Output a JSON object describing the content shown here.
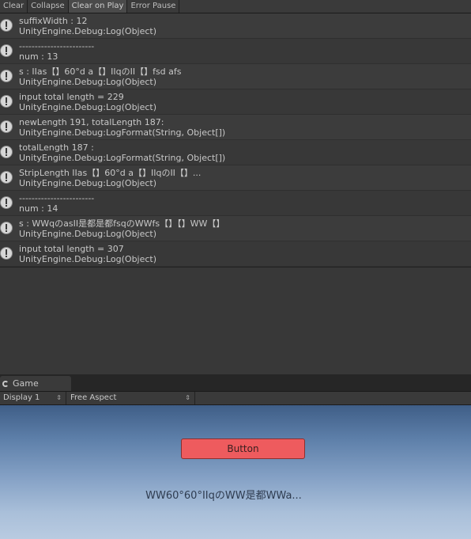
{
  "console": {
    "toolbar": {
      "clear": "Clear",
      "collapse": "Collapse",
      "clear_on_play": "Clear on Play",
      "error_pause": "Error Pause"
    },
    "entries": [
      {
        "line1": "suffixWidth : 12",
        "line2": "UnityEngine.Debug:Log(Object)"
      },
      {
        "line1": "------------------------",
        "line2": " num : 13"
      },
      {
        "line1": "s : IIas【】60°d a【】IIqのII【】fsd afs",
        "line2": "UnityEngine.Debug:Log(Object)"
      },
      {
        "line1": "input total length = 229",
        "line2": "UnityEngine.Debug:Log(Object)"
      },
      {
        "line1": "newLength 191,  totalLength 187:",
        "line2": "UnityEngine.Debug:LogFormat(String, Object[])"
      },
      {
        "line1": "totalLength 187 :",
        "line2": "UnityEngine.Debug:LogFormat(String, Object[])"
      },
      {
        "line1": "StripLength IIas【】60°d a【】IIqのII【】...",
        "line2": "UnityEngine.Debug:Log(Object)"
      },
      {
        "line1": "------------------------",
        "line2": " num : 14"
      },
      {
        "line1": "s : WWqのasII是都是都fsqのWWfs【】【】WW【】",
        "line2": "UnityEngine.Debug:Log(Object)"
      },
      {
        "line1": "input total length = 307",
        "line2": "UnityEngine.Debug:Log(Object)"
      }
    ]
  },
  "game": {
    "tab_label": "Game",
    "display": "Display 1",
    "aspect": "Free Aspect",
    "button_label": "Button",
    "text": "WW60°60°IIqのWW是都WWa..."
  }
}
